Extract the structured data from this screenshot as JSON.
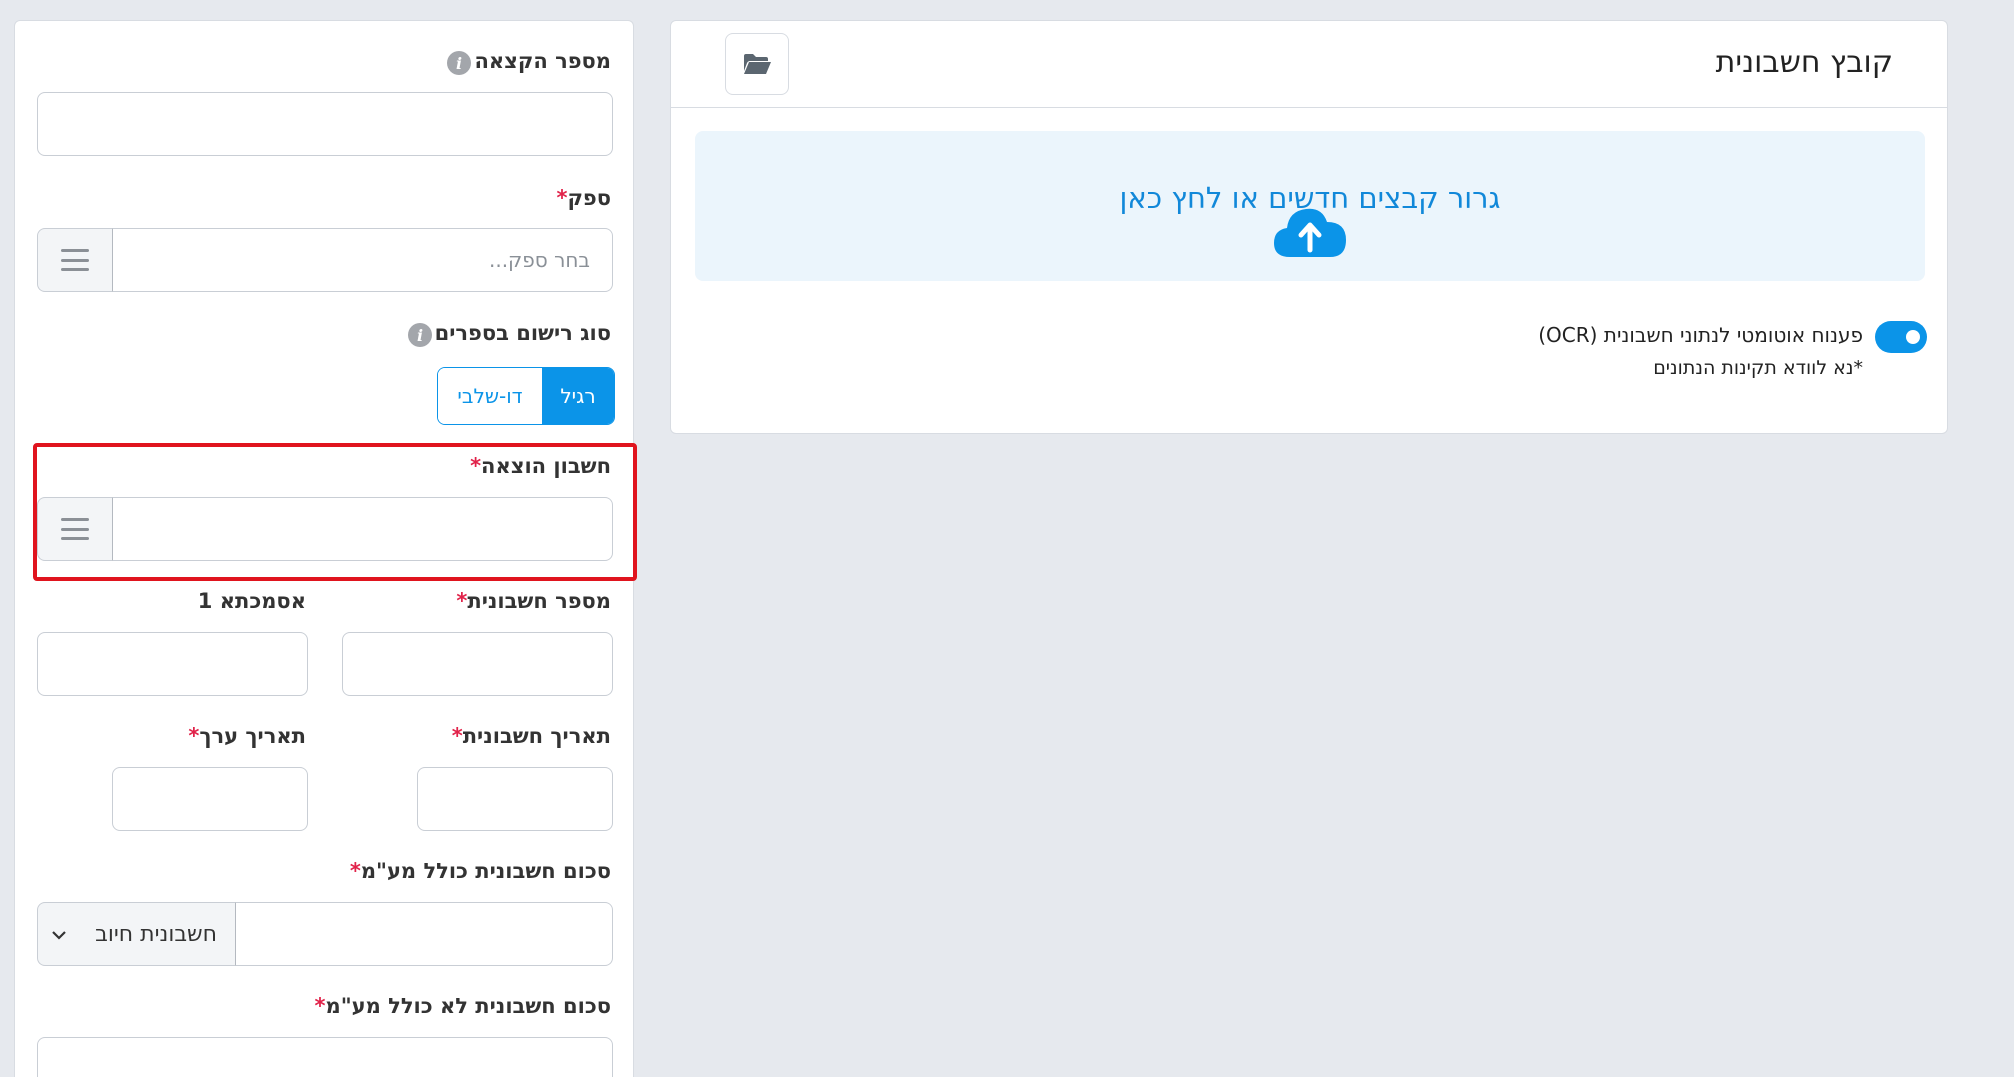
{
  "form": {
    "allocation_number_label": "מספר הקצאה",
    "supplier_label": "ספק",
    "supplier_placeholder": "בחר ספק...",
    "booking_type_label": "סוג רישום בספרים",
    "booking_type_options": [
      "רגיל",
      "דו-שלבי"
    ],
    "expense_account_label": "חשבון הוצאה",
    "invoice_number_label": "מספר חשבונית",
    "reference1_label": "אסמכתא 1",
    "invoice_date_label": "תאריך חשבונית",
    "value_date_label": "תאריך ערך",
    "amount_incl_vat_label": "סכום חשבונית כולל מע\"מ",
    "invoice_type_selected": "חשבונית חיוב",
    "amount_excl_vat_label": "סכום חשבונית לא כולל מע\"מ",
    "required_mark": "*"
  },
  "upload": {
    "title": "קובץ חשבונית",
    "drop_text": "גרור קבצים חדשים או לחץ כאן",
    "ocr_label": "פענוח אוטומטי לנתוני חשבונית (OCR)",
    "ocr_note": "*נא לוודא תקינות הנתונים",
    "ocr_enabled": true
  },
  "colors": {
    "accent": "#0b94e8",
    "required": "#e1234a",
    "highlight": "#e0141e"
  },
  "icons": [
    "info-icon",
    "list-icon",
    "folder-open-icon",
    "cloud-upload-icon",
    "chevron-down-icon"
  ]
}
